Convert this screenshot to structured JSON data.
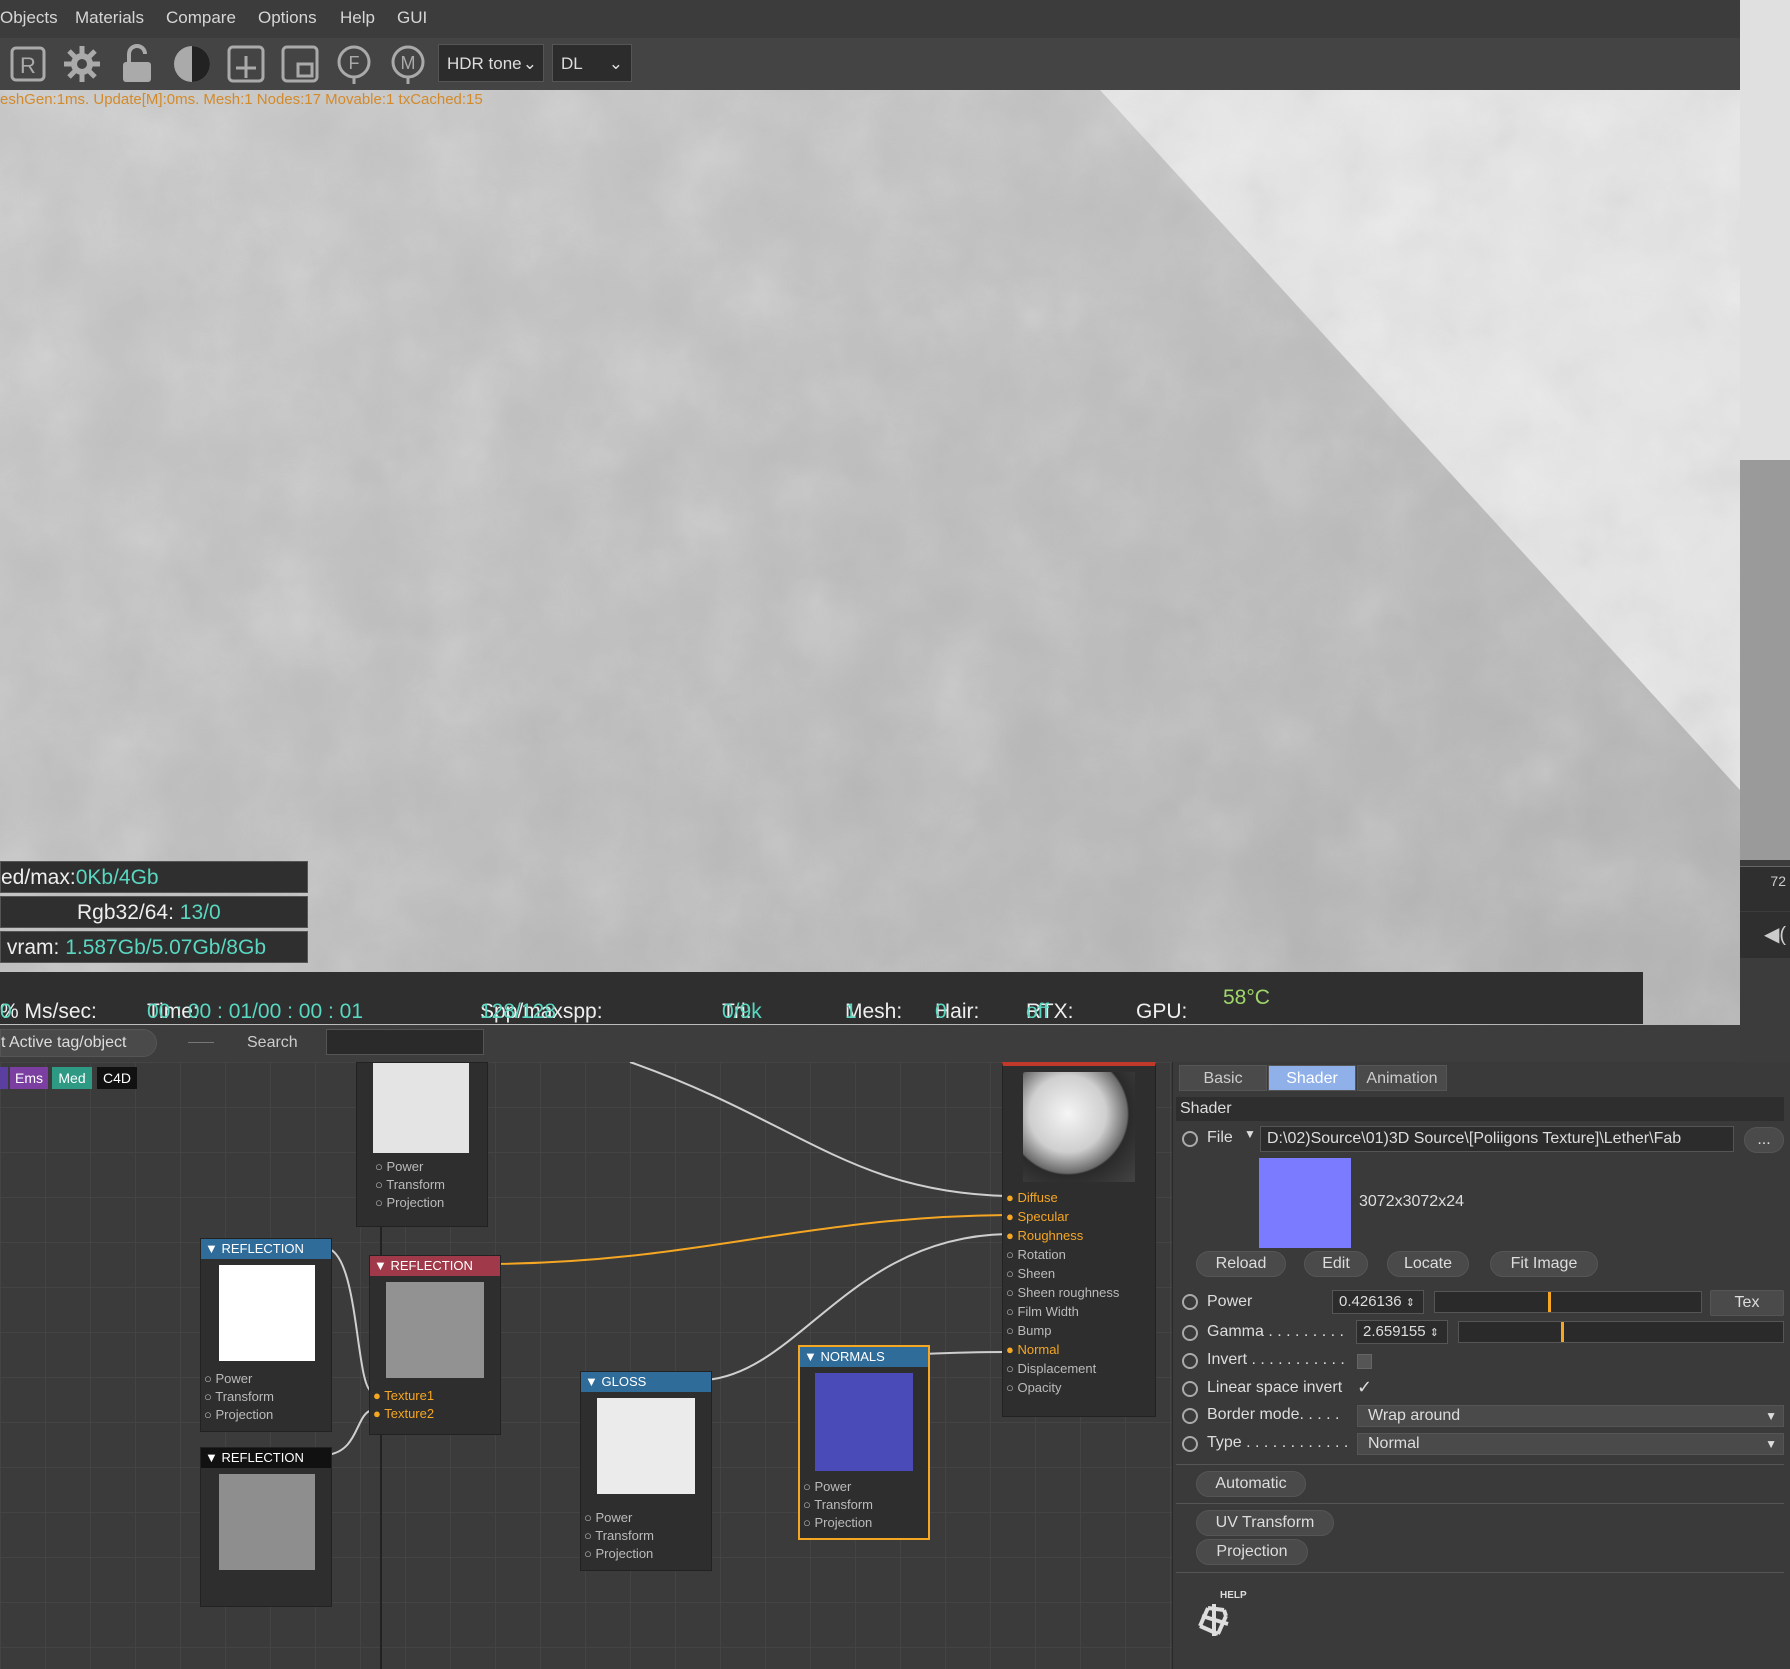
{
  "menu": [
    "Objects",
    "Materials",
    "Compare",
    "Options",
    "Help",
    "GUI"
  ],
  "toolbar": {
    "icons": [
      "R",
      "gear-icon",
      "unlock-icon",
      "contrast-icon",
      "add-icon",
      "object-icon",
      "F",
      "M"
    ],
    "hdr_select": "HDR tone",
    "dl_select": "DL"
  },
  "viewport": {
    "info": "eshGen:1ms. Update[M]:0ms. Mesh:1 Nodes:17 Movable:1 txCached:15",
    "stat1_label": "ed/max:",
    "stat1_value": "0Kb/4Gb",
    "stat2_label": "Rgb32/64:",
    "stat2_value": "13/0",
    "stat3_label": "vram:",
    "stat3_value": "1.587Gb/5.07Gb/8Gb"
  },
  "status": {
    "ms_label": "% Ms/sec:",
    "ms_value": "0",
    "time_label": "Time:",
    "time_value": "00 : 00 : 01/00 : 00 : 01",
    "spp_label": "Spp/maxspp:",
    "spp_value": "128/128",
    "tri_label": "Tri:",
    "tri_value": "0/9k",
    "mesh_label": "Mesh:",
    "mesh_value": "1",
    "hair_label": "Hair:",
    "hair_value": "0",
    "rtx_label": "RTX:",
    "rtx_value": "off",
    "gpu_label": "GPU:",
    "gpu_value": "58°C"
  },
  "rightstrip": {
    "number": "72"
  },
  "search": {
    "active_button": "t Active tag/object",
    "search_label": "Search",
    "search_value": ""
  },
  "tags": [
    {
      "label": "Ems",
      "color": "#7a3fa0"
    },
    {
      "label": "Med",
      "color": "#2f9a84"
    },
    {
      "label": "C4D",
      "color": "#111111"
    }
  ],
  "nodes": {
    "top": {
      "pins": [
        "Power",
        "Transform",
        "Projection"
      ]
    },
    "refl_a": {
      "title": "REFLECTION",
      "pins": [
        "Power",
        "Transform",
        "Projection"
      ]
    },
    "refl_b": {
      "title": "REFLECTION",
      "pins": [
        "Texture1",
        "Texture2"
      ]
    },
    "refl_c": {
      "title": "REFLECTION"
    },
    "gloss": {
      "title": "GLOSS",
      "pins": [
        "Power",
        "Transform",
        "Projection"
      ]
    },
    "normals": {
      "title": "NORMALS",
      "pins": [
        "Power",
        "Transform",
        "Projection"
      ]
    },
    "material": {
      "pins": [
        "Diffuse",
        "Specular",
        "Roughness",
        "Rotation",
        "Sheen",
        "Sheen roughness",
        "Film Width",
        "Bump",
        "Normal",
        "Displacement",
        "Opacity"
      ]
    }
  },
  "props": {
    "tabs": [
      "Basic",
      "Shader",
      "Animation"
    ],
    "section": "Shader",
    "file_label": "File",
    "file_path": "D:\\02)Source\\01)3D Source\\[Poliigons Texture]\\Lether\\Fab",
    "file_btn": "...",
    "image_info": "3072x3072x24",
    "buttons": [
      "Reload",
      "Edit",
      "Locate",
      "Fit Image"
    ],
    "power_label": "Power",
    "power_value": "0.426136",
    "power_fraction": 0.426136,
    "tex_btn": "Tex",
    "gamma_label": "Gamma . . . . . . . . .",
    "gamma_value": "2.659155",
    "invert_label": "Invert . . . . . . . . . . .",
    "linear_label": "Linear space invert",
    "border_label": "Border mode. . . . .",
    "border_value": "Wrap around",
    "type_label": "Type . . . . . . . . . . . .",
    "type_value": "Normal",
    "automatic_btn": "Automatic",
    "uv_btn": "UV Transform",
    "proj_btn": "Projection",
    "help_label": "HELP"
  },
  "colors": {
    "accent_orange": "#f5a623",
    "stat_cyan": "#59d7c0",
    "normal_blue": "#7b7bff",
    "normals_node": "#4a4ab8"
  }
}
